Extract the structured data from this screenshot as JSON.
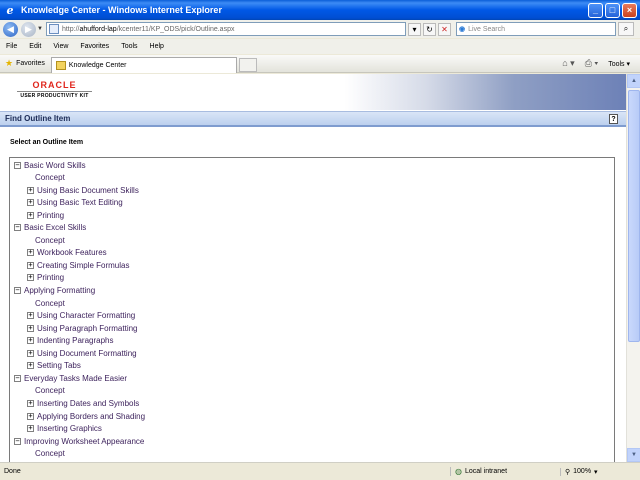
{
  "window": {
    "title": "Knowledge Center - Windows Internet Explorer",
    "buttons": {
      "minimize": "_",
      "maximize": "□",
      "close": "×"
    }
  },
  "addressbar": {
    "prefix": "http://",
    "host": "ahufford-lap",
    "path": "/kcenter11/KP_ODS/pick/Outline.aspx",
    "search_placeholder": "Live Search"
  },
  "menu": [
    "File",
    "Edit",
    "View",
    "Favorites",
    "Tools",
    "Help"
  ],
  "favbar": {
    "favorites_label": "Favorites",
    "tab_label": "Knowledge Center",
    "tools_label": "Tools"
  },
  "banner": {
    "logo_top": "ORACLE",
    "logo_bottom": "USER PRODUCTIVITY KIT"
  },
  "header": {
    "title": "Find Outline Item",
    "help": "?"
  },
  "subtitle": "Select an Outline Item",
  "tree": [
    {
      "label": "Basic Word Skills",
      "level": 0,
      "toggle": "−"
    },
    {
      "label": "Concept",
      "level": 1,
      "toggle": ""
    },
    {
      "label": "Using Basic Document Skills",
      "level": 1,
      "toggle": "+"
    },
    {
      "label": "Using Basic Text Editing",
      "level": 1,
      "toggle": "+"
    },
    {
      "label": "Printing",
      "level": 1,
      "toggle": "+"
    },
    {
      "label": "Basic Excel Skills",
      "level": 0,
      "toggle": "−"
    },
    {
      "label": "Concept",
      "level": 1,
      "toggle": ""
    },
    {
      "label": "Workbook Features",
      "level": 1,
      "toggle": "+"
    },
    {
      "label": "Creating Simple Formulas",
      "level": 1,
      "toggle": "+"
    },
    {
      "label": "Printing",
      "level": 1,
      "toggle": "+"
    },
    {
      "label": "Applying Formatting",
      "level": 0,
      "toggle": "−"
    },
    {
      "label": "Concept",
      "level": 1,
      "toggle": ""
    },
    {
      "label": "Using Character Formatting",
      "level": 1,
      "toggle": "+"
    },
    {
      "label": "Using Paragraph Formatting",
      "level": 1,
      "toggle": "+"
    },
    {
      "label": "Indenting Paragraphs",
      "level": 1,
      "toggle": "+"
    },
    {
      "label": "Using Document Formatting",
      "level": 1,
      "toggle": "+"
    },
    {
      "label": "Setting Tabs",
      "level": 1,
      "toggle": "+"
    },
    {
      "label": "Everyday Tasks Made Easier",
      "level": 0,
      "toggle": "−"
    },
    {
      "label": "Concept",
      "level": 1,
      "toggle": ""
    },
    {
      "label": "Inserting Dates and Symbols",
      "level": 1,
      "toggle": "+"
    },
    {
      "label": "Applying Borders and Shading",
      "level": 1,
      "toggle": "+"
    },
    {
      "label": "Inserting Graphics",
      "level": 1,
      "toggle": "+"
    },
    {
      "label": "Improving Worksheet Appearance",
      "level": 0,
      "toggle": "−"
    },
    {
      "label": "Concept",
      "level": 1,
      "toggle": ""
    }
  ],
  "statusbar": {
    "status": "Done",
    "zone": "Local intranet",
    "zoom": "100%"
  }
}
